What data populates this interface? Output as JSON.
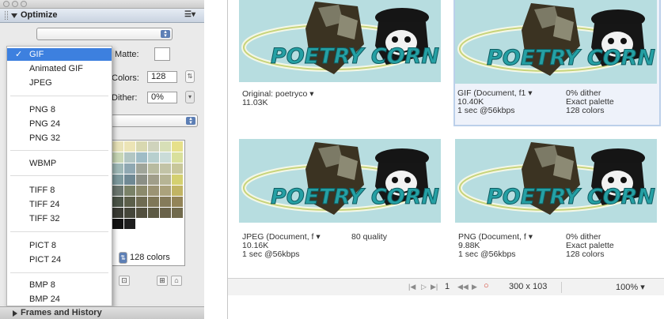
{
  "panel": {
    "title": "Optimize",
    "menu_icon": "panel-menu-icon",
    "preset_value": "",
    "matte_label": "Matte:",
    "colors_label": "Colors:",
    "colors_value": "128",
    "dither_label": "Dither:",
    "dither_value": "0%",
    "colors_count": "128 colors",
    "frames_label": "Frames and History"
  },
  "format_menu": {
    "items": [
      {
        "label": "GIF",
        "selected": true
      },
      {
        "label": "Animated GIF"
      },
      {
        "label": "JPEG"
      },
      {
        "label": "PNG 8"
      },
      {
        "label": "PNG 24"
      },
      {
        "label": "PNG 32"
      },
      {
        "label": "WBMP"
      },
      {
        "label": "TIFF 8"
      },
      {
        "label": "TIFF 24"
      },
      {
        "label": "TIFF 32"
      },
      {
        "label": "PICT 8"
      },
      {
        "label": "PICT 24"
      },
      {
        "label": "BMP 8"
      },
      {
        "label": "BMP 24"
      }
    ],
    "checkmark": "✓"
  },
  "palette": {
    "colors": [
      "#e8e2b8",
      "#ece4b6",
      "#d8d8b0",
      "#cfd3bc",
      "#d7dfb7",
      "#e6e08a",
      "#c8d6b5",
      "#b2c6c3",
      "#9fbcc6",
      "#b7cfce",
      "#cadcd8",
      "#d9e09c",
      "#9fb8b6",
      "#8fa8b2",
      "#a0a59a",
      "#b8bba0",
      "#c2c3a6",
      "#c8c79a",
      "#7e9a9e",
      "#6f8994",
      "#8b8f86",
      "#a09e8a",
      "#b6b494",
      "#d4d070",
      "#6c7770",
      "#7a8268",
      "#8c8a6c",
      "#9b9374",
      "#aba27c",
      "#c1b464",
      "#4c5548",
      "#5c5f4a",
      "#6f6b52",
      "#7f7758",
      "#857b5a",
      "#938458",
      "#3a3b34",
      "#45463a",
      "#524f3e",
      "#5d5a44",
      "#6a634a",
      "#716a4c",
      "#111111",
      "#1e1e1e"
    ]
  },
  "preview": {
    "image_text": "POETRY CORN",
    "tiles": [
      {
        "line1": "Original: poetryco",
        "line2": "11.03K",
        "line3": "",
        "col2": [
          "",
          "",
          ""
        ]
      },
      {
        "line1": "GIF (Document, f1",
        "line2": "10.40K",
        "line3": "1 sec @56kbps",
        "col2": [
          "0% dither",
          "Exact palette",
          "128 colors"
        ]
      },
      {
        "line1": "JPEG (Document, f",
        "line2": "10.16K",
        "line3": "1 sec @56kbps",
        "col2": [
          "80 quality",
          "",
          ""
        ]
      },
      {
        "line1": "PNG (Document, f",
        "line2": "9.88K",
        "line3": "1 sec @56kbps",
        "col2": [
          "0% dither",
          "Exact palette",
          "128 colors"
        ]
      }
    ],
    "status": {
      "frame_number": "1",
      "dimensions": "300 x 103",
      "zoom": "100%"
    }
  }
}
